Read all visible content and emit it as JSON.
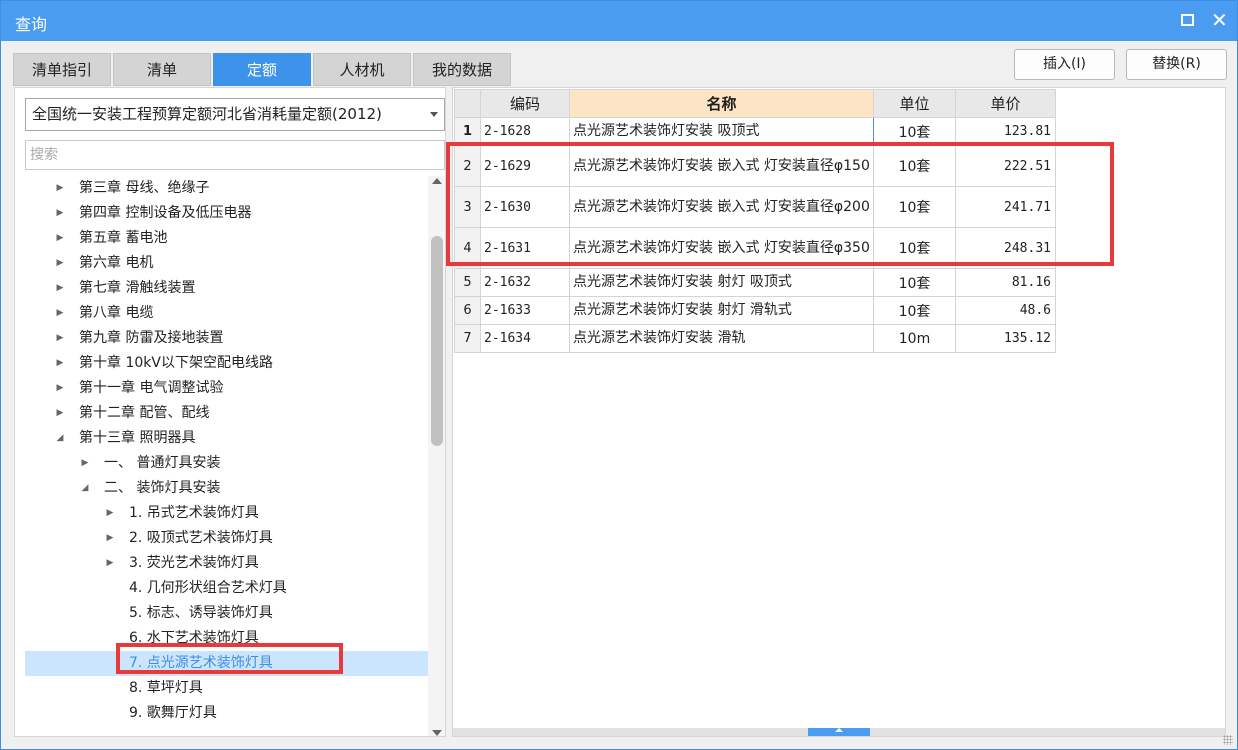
{
  "window": {
    "title": "查询"
  },
  "tabs": [
    {
      "label": "清单指引",
      "active": false
    },
    {
      "label": "清单",
      "active": false
    },
    {
      "label": "定额",
      "active": true
    },
    {
      "label": "人材机",
      "active": false
    },
    {
      "label": "我的数据",
      "active": false
    }
  ],
  "toolbar": {
    "insert_label": "插入(I)",
    "replace_label": "替换(R)"
  },
  "library": {
    "selected": "全国统一安装工程预算定额河北省消耗量定额(2012)"
  },
  "search": {
    "placeholder": "搜索"
  },
  "tree": {
    "ch3": "第三章 母线、绝缘子",
    "ch4": "第四章 控制设备及低压电器",
    "ch5": "第五章 蓄电池",
    "ch6": "第六章 电机",
    "ch7": "第七章 滑触线装置",
    "ch8": "第八章 电缆",
    "ch9": "第九章 防雷及接地装置",
    "ch10": "第十章 10kV以下架空配电线路",
    "ch11": "第十一章 电气调整试验",
    "ch12": "第十二章 配管、配线",
    "ch13": "第十三章 照明器具",
    "s1": "一、 普通灯具安装",
    "s2": "二、 装饰灯具安装",
    "i1": "1. 吊式艺术装饰灯具",
    "i2": "2. 吸顶式艺术装饰灯具",
    "i3": "3. 荧光艺术装饰灯具",
    "i4": "4. 几何形状组合艺术灯具",
    "i5": "5. 标志、诱导装饰灯具",
    "i6": "6. 水下艺术装饰灯具",
    "i7": "7. 点光源艺术装饰灯具",
    "i8": "8. 草坪灯具",
    "i9": "9. 歌舞厅灯具"
  },
  "grid": {
    "headers": {
      "code": "编码",
      "name": "名称",
      "unit": "单位",
      "price": "单价"
    },
    "rows": [
      {
        "n": "1",
        "code": "2-1628",
        "name": "点光源艺术装饰灯安装 吸顶式",
        "unit": "10套",
        "price": "123.81"
      },
      {
        "n": "2",
        "code": "2-1629",
        "name": "点光源艺术装饰灯安装 嵌入式 灯安装直径φ150",
        "unit": "10套",
        "price": "222.51"
      },
      {
        "n": "3",
        "code": "2-1630",
        "name": "点光源艺术装饰灯安装 嵌入式 灯安装直径φ200",
        "unit": "10套",
        "price": "241.71"
      },
      {
        "n": "4",
        "code": "2-1631",
        "name": "点光源艺术装饰灯安装 嵌入式 灯安装直径φ350",
        "unit": "10套",
        "price": "248.31"
      },
      {
        "n": "5",
        "code": "2-1632",
        "name": "点光源艺术装饰灯安装 射灯 吸顶式",
        "unit": "10套",
        "price": "81.16"
      },
      {
        "n": "6",
        "code": "2-1633",
        "name": "点光源艺术装饰灯安装 射灯 滑轨式",
        "unit": "10套",
        "price": "48.6"
      },
      {
        "n": "7",
        "code": "2-1634",
        "name": "点光源艺术装饰灯安装 滑轨",
        "unit": "10m",
        "price": "135.12"
      }
    ]
  },
  "colors": {
    "titlebar": "#4a9cf0",
    "active_tab": "#3d93ea",
    "highlight": "#e8393b",
    "selection": "#cce5ff"
  }
}
